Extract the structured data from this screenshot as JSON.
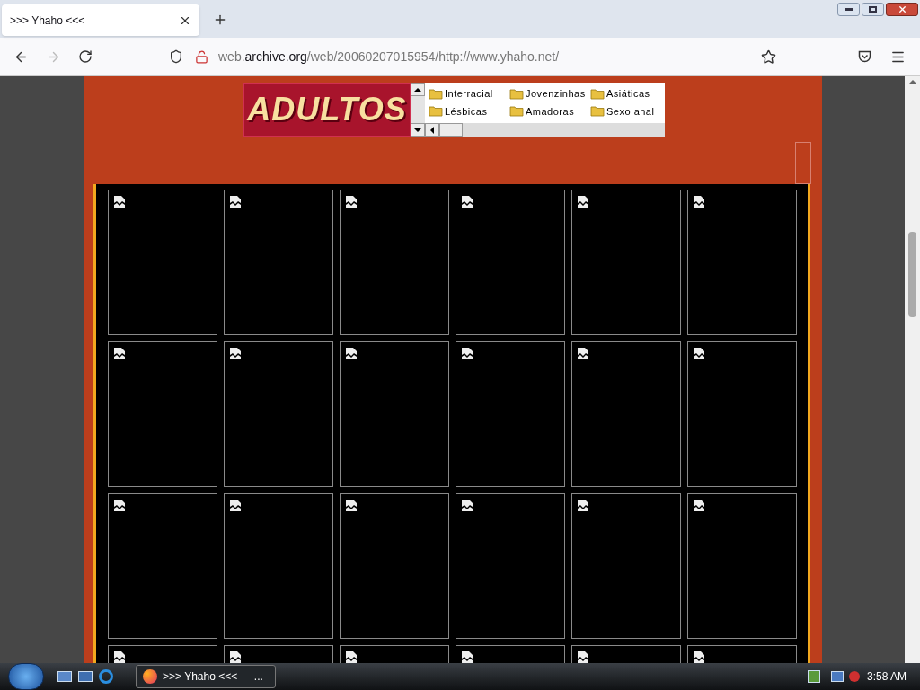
{
  "browser": {
    "tab": {
      "title": ">>> Yhaho <<<",
      "selected": true
    },
    "address": {
      "prefix": "web.",
      "domain": "archive.org",
      "path": "/web/20060207015954/http://www.yhaho.net/"
    }
  },
  "page": {
    "logo": "ADULTOS",
    "categories": [
      "Interracial",
      "Jovenzinhas",
      "Asiáticas",
      "Lésbicas",
      "Amadoras",
      "Sexo anal"
    ],
    "tiles": [
      {
        "kind": "broken-image"
      },
      {
        "kind": "broken-image"
      },
      {
        "kind": "broken-image"
      },
      {
        "kind": "broken-image"
      },
      {
        "kind": "broken-image"
      },
      {
        "kind": "broken-image"
      },
      {
        "kind": "broken-image"
      },
      {
        "kind": "broken-image"
      },
      {
        "kind": "broken-image"
      },
      {
        "kind": "broken-image"
      },
      {
        "kind": "broken-image"
      },
      {
        "kind": "broken-image"
      },
      {
        "kind": "broken-image"
      },
      {
        "kind": "broken-image"
      },
      {
        "kind": "broken-image"
      },
      {
        "kind": "broken-image"
      },
      {
        "kind": "broken-image"
      },
      {
        "kind": "broken-image"
      },
      {
        "kind": "broken-image"
      },
      {
        "kind": "broken-image"
      },
      {
        "kind": "broken-image"
      },
      {
        "kind": "broken-image"
      },
      {
        "kind": "broken-image"
      },
      {
        "kind": "broken-image"
      }
    ]
  },
  "taskbar": {
    "task": ">>> Yhaho <<< — ...",
    "clock": "3:58 AM"
  }
}
